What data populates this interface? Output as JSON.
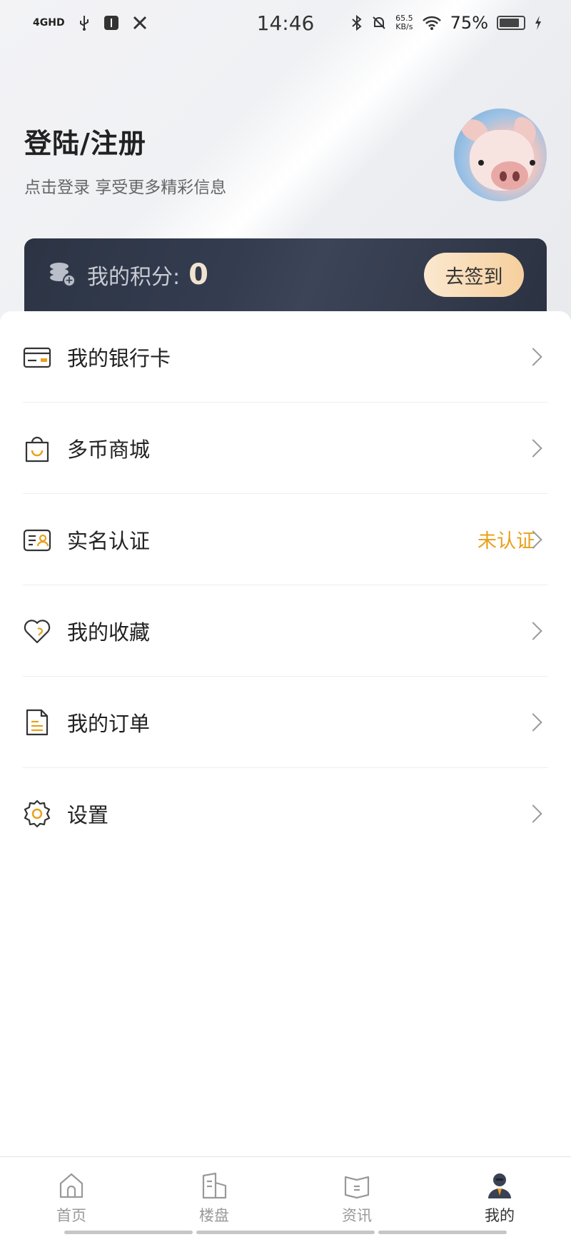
{
  "status_bar": {
    "network": "4GHD",
    "time": "14:46",
    "net_speed_value": "65.5",
    "net_speed_unit": "KB/s",
    "battery": "75%"
  },
  "profile": {
    "title": "登陆/注册",
    "subtitle": "点击登录 享受更多精彩信息"
  },
  "points": {
    "label": "我的积分:",
    "value": "0",
    "checkin_label": "去签到"
  },
  "menu": [
    {
      "label": "我的银行卡",
      "icon": "bank-card-icon",
      "badge": ""
    },
    {
      "label": "多币商城",
      "icon": "shopping-bag-icon",
      "badge": ""
    },
    {
      "label": "实名认证",
      "icon": "id-card-icon",
      "badge": "未认证"
    },
    {
      "label": "我的收藏",
      "icon": "heart-icon",
      "badge": ""
    },
    {
      "label": "我的订单",
      "icon": "order-document-icon",
      "badge": ""
    },
    {
      "label": "设置",
      "icon": "gear-icon",
      "badge": ""
    }
  ],
  "colors": {
    "accent": "#e8a11d",
    "card_dark": "#2c3444",
    "checkin_gradient_start": "#fbe8cf",
    "checkin_gradient_end": "#f6cf9d"
  },
  "tabs": [
    {
      "label": "首页",
      "icon": "home-icon",
      "active": false
    },
    {
      "label": "楼盘",
      "icon": "building-icon",
      "active": false
    },
    {
      "label": "资讯",
      "icon": "news-book-icon",
      "active": false
    },
    {
      "label": "我的",
      "icon": "user-avatar-icon",
      "active": true
    }
  ]
}
